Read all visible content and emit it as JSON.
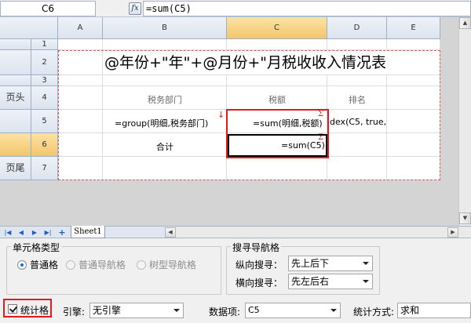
{
  "formula_bar": {
    "cell_ref": "C6",
    "fx_label": "fx",
    "formula": "=sum(C5)"
  },
  "grid": {
    "col_headers": [
      "A",
      "B",
      "C",
      "D",
      "E"
    ],
    "row_headers": [
      "1",
      "2",
      "3",
      "4",
      "5",
      "6",
      "7"
    ],
    "row_labels": {
      "r4": "页头",
      "r7": "页尾"
    },
    "title": "@年份+\"年\"+@月份+\"月税收收入情况表",
    "header_department": "税务部门",
    "header_tax": "税额",
    "header_rank": "排名",
    "cell_b5": "=group(明细,税务部门)",
    "cell_c5": "=sum(明细,税额)",
    "cell_d5": "dex(C5, true,",
    "cell_b6": "合计",
    "cell_c6": "=sum(C5)",
    "sigma_glyph": "Σ",
    "arrow_glyph": "↓"
  },
  "sheet_tabs": {
    "active": "Sheet1",
    "nav": [
      "|◀",
      "◀",
      "▶",
      "▶|",
      "+"
    ]
  },
  "panel": {
    "cell_type_label": "单元格类型",
    "radios": [
      {
        "label": "普通格",
        "selected": true,
        "disabled": false
      },
      {
        "label": "普通导航格",
        "selected": false,
        "disabled": true
      },
      {
        "label": "树型导航格",
        "selected": false,
        "disabled": true
      }
    ],
    "search_nav_label": "搜寻导航格",
    "vertical_label": "纵向搜寻：",
    "vertical_value": "先上后下",
    "horizontal_label": "横向搜寻：",
    "horizontal_value": "先左后右",
    "stat_checkbox_label": "统计格",
    "stat_checked": true,
    "engine_label": "引擎:",
    "engine_value": "无引擎",
    "data_item_label": "数据项:",
    "data_item_value": "C5",
    "stat_method_label": "统计方式:",
    "stat_method_value": "求和"
  },
  "colors": {
    "selection_red": "#e11b1b",
    "header_selected": "#f4c66c",
    "radio_accent": "#1a6ed8"
  }
}
